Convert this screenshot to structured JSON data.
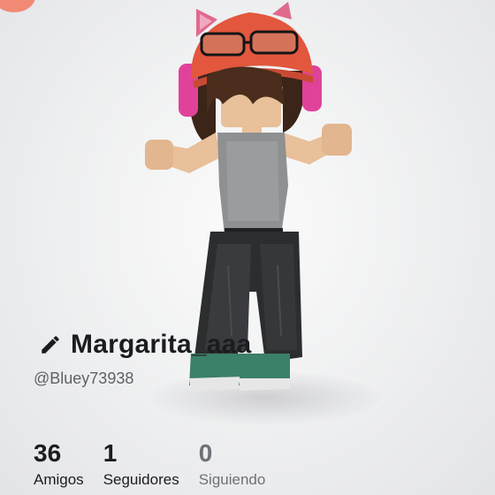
{
  "profile": {
    "display_name": "Margarita_aaa",
    "username": "@Bluey73938",
    "edit_icon": "pencil-icon"
  },
  "stats": [
    {
      "count": "36",
      "label": "Amigos"
    },
    {
      "count": "1",
      "label": "Seguidores"
    },
    {
      "count": "0",
      "label": "Siguiendo"
    }
  ],
  "colors": {
    "text_primary": "#1b1c1f",
    "text_secondary": "#5f6166",
    "text_muted": "#6e7177",
    "corner_badge": "#f08a74",
    "hat": "#e2573d",
    "headphones": "#e0429a",
    "shirt": "#8f9092",
    "pants": "#2c2d2f",
    "shoes": "#3b8068",
    "skin": "#e8c09a",
    "hair": "#3b2418"
  }
}
